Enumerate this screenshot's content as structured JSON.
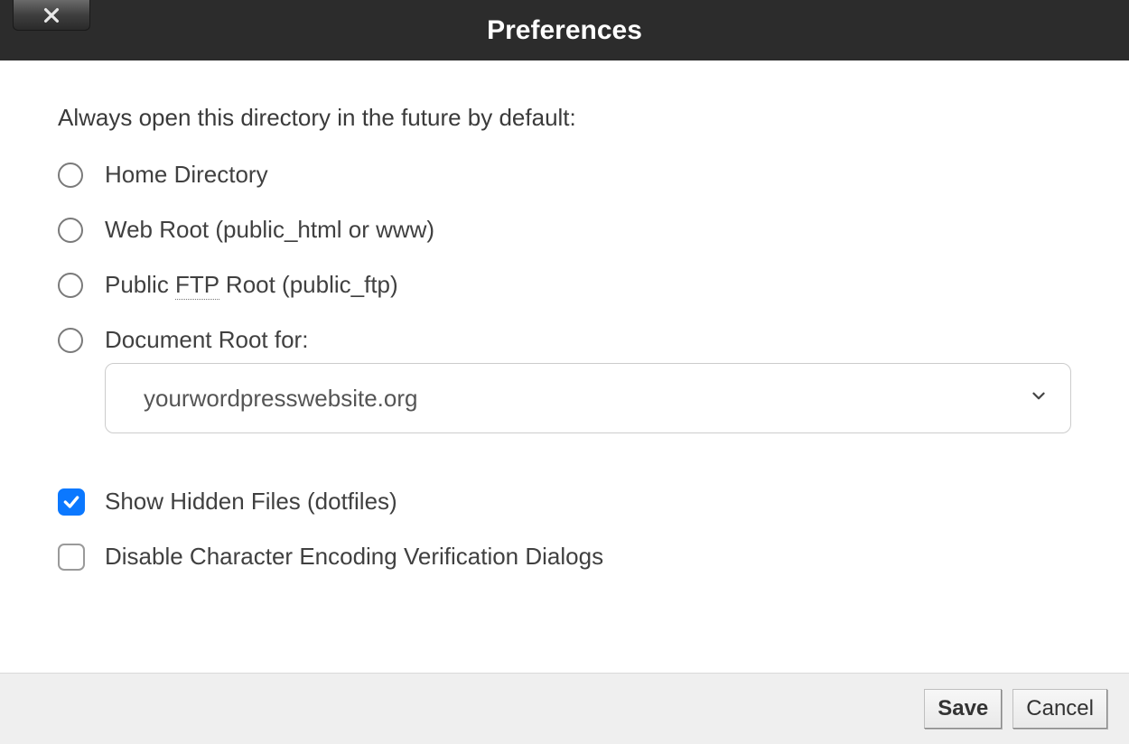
{
  "dialog": {
    "title": "Preferences",
    "prompt": "Always open this directory in the future by default:",
    "radios": {
      "home": "Home Directory",
      "webroot": "Web Root (public_html or www)",
      "ftp_prefix": "Public ",
      "ftp_abbr": "FTP",
      "ftp_suffix": " Root (public_ftp)",
      "docroot": "Document Root for:"
    },
    "domain_selected": "yourwordpresswebsite.org",
    "checkboxes": {
      "show_hidden": "Show Hidden Files (dotfiles)",
      "disable_enc": "Disable Character Encoding Verification Dialogs"
    },
    "buttons": {
      "save": "Save",
      "cancel": "Cancel"
    }
  }
}
